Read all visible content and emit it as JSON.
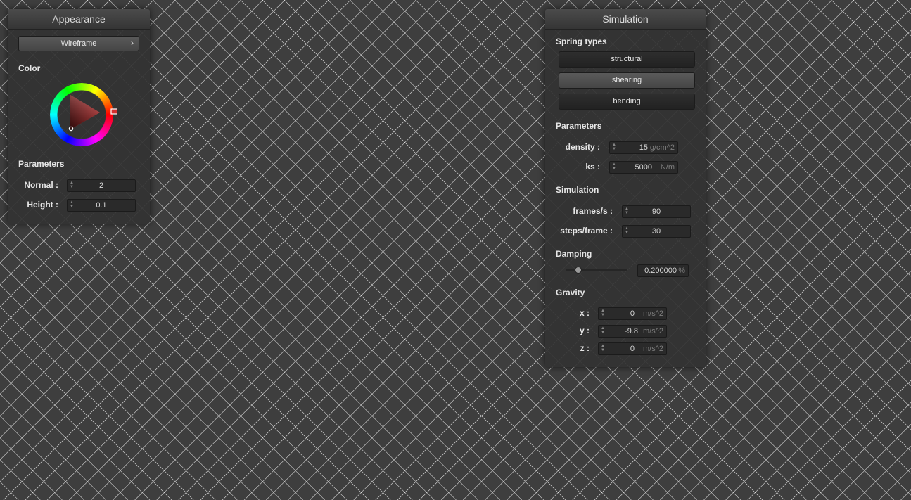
{
  "appearance": {
    "title": "Appearance",
    "mode_button": "Wireframe",
    "mode_arrow": "›",
    "color_label": "Color",
    "color_value": "#d32f2f",
    "parameters_label": "Parameters",
    "normal": {
      "label": "Normal :",
      "value": "2"
    },
    "height": {
      "label": "Height :",
      "value": "0.1"
    }
  },
  "simulation": {
    "title": "Simulation",
    "spring_types_label": "Spring types",
    "spring_types": [
      "structural",
      "shearing",
      "bending"
    ],
    "parameters_label": "Parameters",
    "density": {
      "label": "density :",
      "value": "15",
      "unit": "g/cm^2"
    },
    "ks": {
      "label": "ks :",
      "value": "5000",
      "unit": "N/m"
    },
    "sim_label": "Simulation",
    "frames": {
      "label": "frames/s :",
      "value": "90"
    },
    "steps": {
      "label": "steps/frame :",
      "value": "30"
    },
    "damping_label": "Damping",
    "damping": {
      "value": "0.200000",
      "unit": "%",
      "fraction": 0.2
    },
    "gravity_label": "Gravity",
    "gx": {
      "label": "x :",
      "value": "0",
      "unit": "m/s^2"
    },
    "gy": {
      "label": "y :",
      "value": "-9.8",
      "unit": "m/s^2"
    },
    "gz": {
      "label": "z :",
      "value": "0",
      "unit": "m/s^2"
    }
  }
}
